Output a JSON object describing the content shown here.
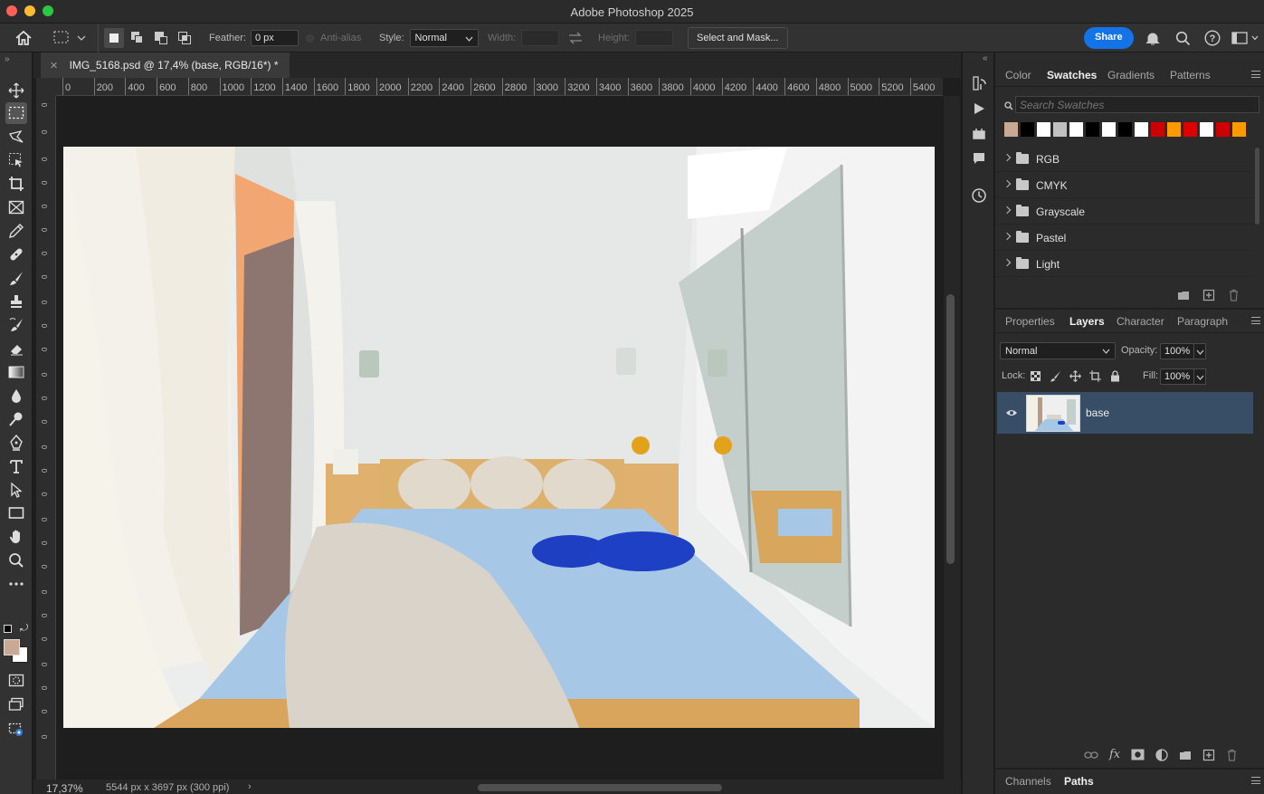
{
  "window": {
    "title": "Adobe Photoshop 2025",
    "traffic_colors": [
      "#fe5f57",
      "#febc2e",
      "#28c840"
    ]
  },
  "options_bar": {
    "feather_label": "Feather:",
    "feather_value": "0 px",
    "anti_alias_label": "Anti-alias",
    "style_label": "Style:",
    "style_value": "Normal",
    "width_label": "Width:",
    "height_label": "Height:",
    "select_mask_label": "Select and Mask...",
    "share_label": "Share",
    "share_color": "#1473e6"
  },
  "document": {
    "tab_title": "IMG_5168.psd @ 17,4% (base, RGB/16*) *",
    "zoom": "17,37%",
    "dimensions": "5544 px x 3697 px (300 ppi)",
    "ruler_h": [
      "0",
      "200",
      "400",
      "600",
      "800",
      "1000",
      "1200",
      "1400",
      "1600",
      "1800",
      "2000",
      "2200",
      "2400",
      "2600",
      "2800",
      "3000",
      "3200",
      "3400",
      "3600",
      "3800",
      "4000",
      "4200",
      "4400",
      "4600",
      "4800",
      "5000",
      "5200",
      "5400"
    ]
  },
  "swatches_panel": {
    "tabs": [
      "Color",
      "Swatches",
      "Gradients",
      "Patterns"
    ],
    "active_tab": "Swatches",
    "search_placeholder": "Search Swatches",
    "recent_colors": [
      "#c9a993",
      "#000000",
      "#ffffff",
      "#c0c0c0",
      "#ffffff",
      "#000000",
      "#ffffff",
      "#000000",
      "#ffffff",
      "#cc0000",
      "#ff9900",
      "#dd0000",
      "#ffffff",
      "#cc0000",
      "#ff9900"
    ],
    "groups": [
      "RGB",
      "CMYK",
      "Grayscale",
      "Pastel",
      "Light"
    ]
  },
  "layers_panel": {
    "tabs": [
      "Properties",
      "Layers",
      "Character",
      "Paragraph"
    ],
    "active_tab": "Layers",
    "blend_mode": "Normal",
    "opacity_label": "Opacity:",
    "opacity_value": "100%",
    "lock_label": "Lock:",
    "fill_label": "Fill:",
    "fill_value": "100%",
    "layers": [
      {
        "name": "base",
        "visible": true,
        "selected": true
      }
    ]
  },
  "bottom_panel": {
    "tabs": [
      "Channels",
      "Paths"
    ],
    "active_tab": "Paths"
  },
  "colors": {
    "foreground": "#c9a993",
    "background": "#ffffff",
    "layer_selected": "#384e66"
  }
}
